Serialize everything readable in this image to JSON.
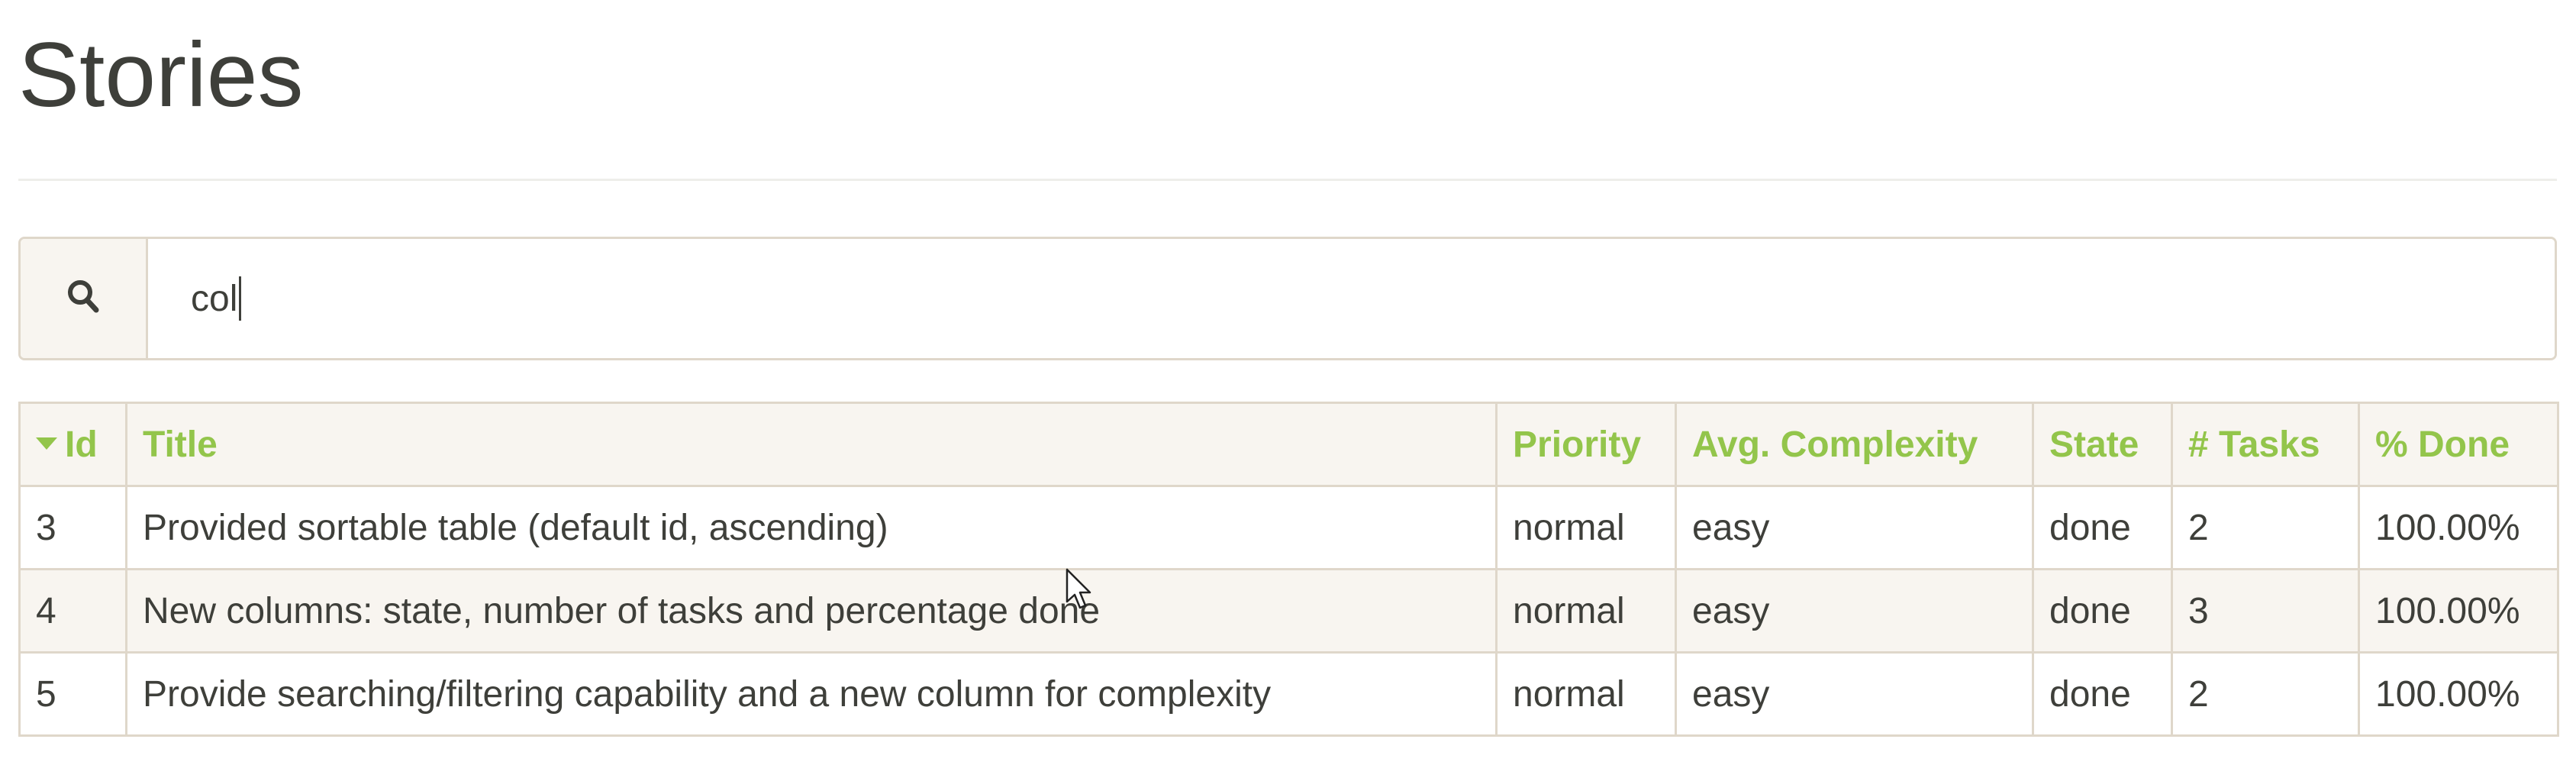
{
  "page": {
    "title": "Stories"
  },
  "search": {
    "icon": "search-icon",
    "value": "col"
  },
  "table": {
    "sorted_column": "Id",
    "sort_direction": "descending-indicator",
    "columns": [
      "Id",
      "Title",
      "Priority",
      "Avg. Complexity",
      "State",
      "# Tasks",
      "% Done"
    ],
    "rows": [
      {
        "id": "3",
        "title": "Provided sortable table (default id, ascending)",
        "priority": "normal",
        "complexity": "easy",
        "state": "done",
        "tasks": "2",
        "done": "100.00%"
      },
      {
        "id": "4",
        "title": "New columns: state, number of tasks and percentage done",
        "priority": "normal",
        "complexity": "easy",
        "state": "done",
        "tasks": "3",
        "done": "100.00%"
      },
      {
        "id": "5",
        "title": "Provide searching/filtering capability and a new column for complexity",
        "priority": "normal",
        "complexity": "easy",
        "state": "done",
        "tasks": "2",
        "done": "100.00%"
      }
    ]
  },
  "colors": {
    "accent": "#93c54b",
    "text": "#3e3f3a",
    "border": "#dfd7ca",
    "header_bg": "#f8f5f0",
    "stripe_bg": "#f8f5f0"
  }
}
